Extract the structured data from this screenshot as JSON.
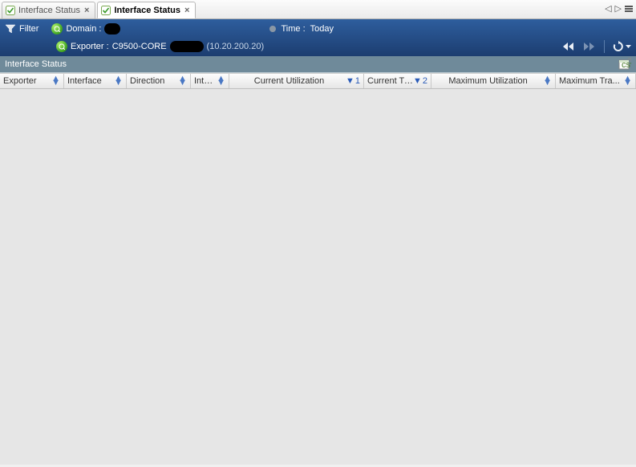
{
  "tabs": {
    "tab0": {
      "label": "Interface Status"
    },
    "tab1": {
      "label": "Interface Status"
    }
  },
  "filter": {
    "label": "Filter",
    "domain_label": "Domain :",
    "exporter_label": "Exporter :",
    "exporter_value": "C9500-CORE",
    "exporter_ip": "(10.20.200.20)",
    "time_label": "Time :",
    "time_value": "Today"
  },
  "section": {
    "title": "Interface Status"
  },
  "columns": {
    "c0": "Exporter",
    "c1": "Interface",
    "c2": "Direction",
    "c3": "Inte...",
    "c4": "Current Utilization",
    "c5": "Current Tra...",
    "c6": "Maximum Utilization",
    "c7": "Maximum Tra..."
  },
  "sort": {
    "c4_order": "1",
    "c5_order": "2"
  }
}
